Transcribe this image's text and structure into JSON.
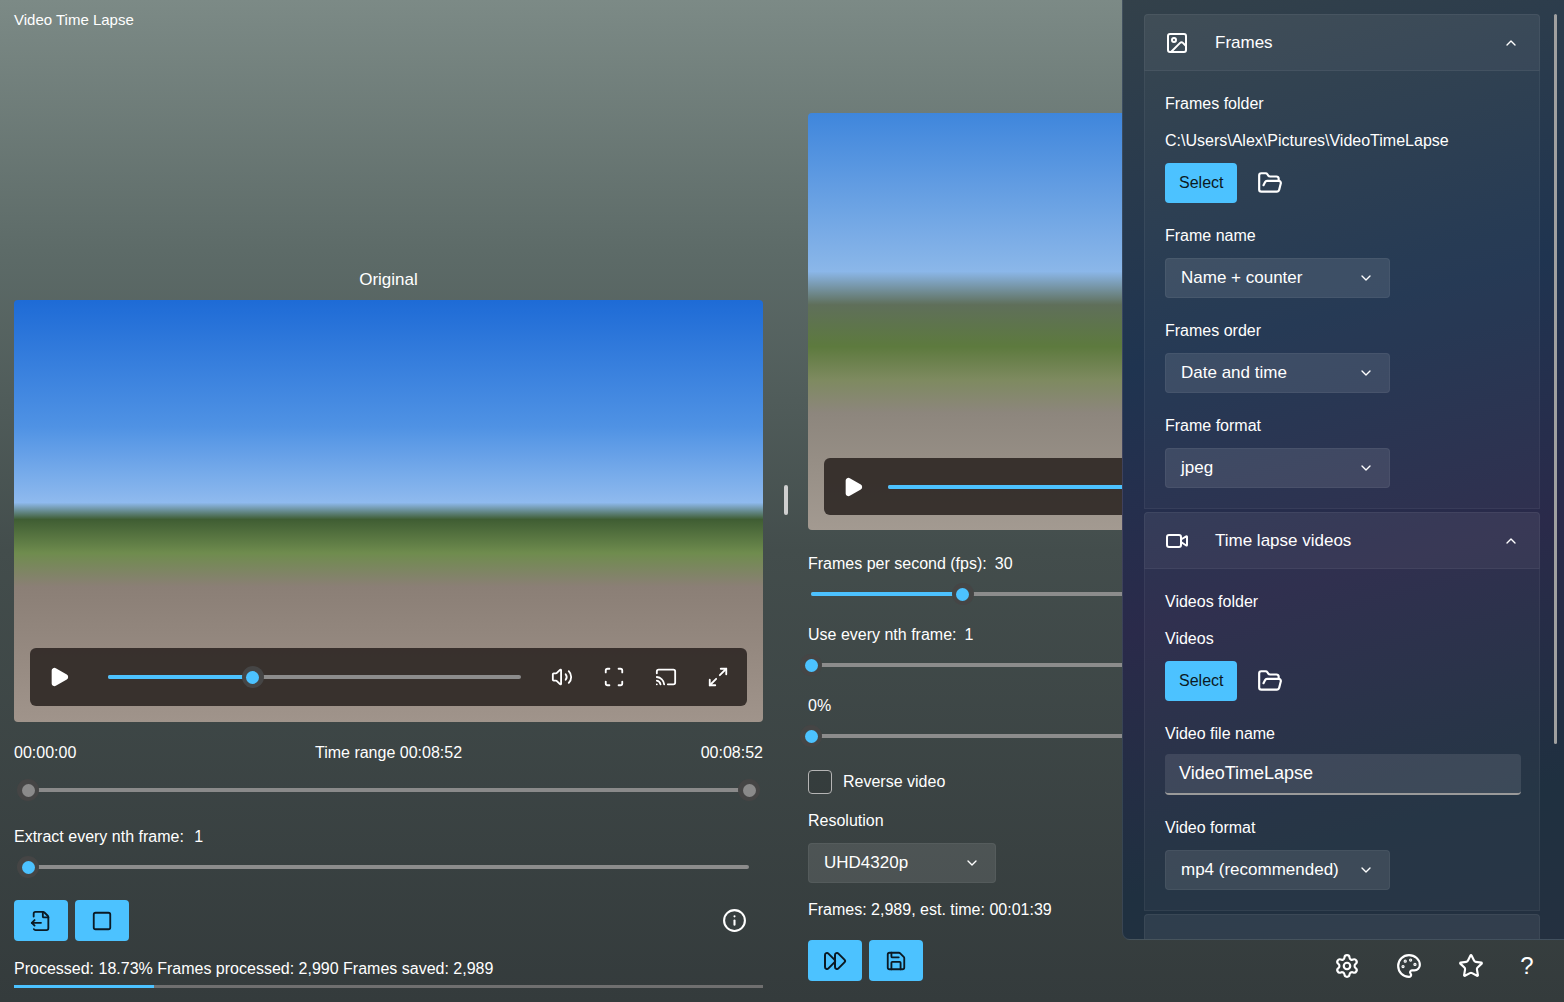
{
  "window": {
    "title": "Video Time Lapse"
  },
  "original": {
    "label": "Original",
    "player": {
      "level": 0.35
    },
    "time_start": "00:00:00",
    "time_range": "Time range 00:08:52",
    "time_end": "00:08:52",
    "range": {
      "start": 0,
      "end": 1,
      "disabled": true
    },
    "extract": {
      "label": "Extract every nth frame:",
      "value": "1",
      "level": 0
    },
    "status": "Processed: 18.73% Frames processed: 2,990 Frames saved: 2,989",
    "progress": {
      "level": 0.1873
    }
  },
  "preview": {
    "player": {
      "level": 0.6
    },
    "sliders": [
      {
        "label": "Frames per second (fps):",
        "value": "30",
        "level": 0.21
      },
      {
        "label": "Use every nth frame:",
        "value": "1",
        "level": 0
      },
      {
        "label": "0%",
        "value": "",
        "level": 0
      }
    ],
    "reverse": {
      "label": "Reverse video",
      "checked": false
    },
    "resolution": {
      "label": "Resolution",
      "value": "UHD4320p"
    },
    "summary": "Frames: 2,989, est. time: 00:01:39"
  },
  "settings_panel": {
    "sections": [
      {
        "title": "Frames",
        "icon": "image",
        "expanded": true,
        "fields": [
          {
            "kind": "folder",
            "label": "Frames folder",
            "value": "C:\\Users\\Alex\\Pictures\\VideoTimeLapse",
            "button": "Select"
          },
          {
            "kind": "dropdown",
            "label": "Frame name",
            "value": "Name + counter"
          },
          {
            "kind": "dropdown",
            "label": "Frames order",
            "value": "Date and time"
          },
          {
            "kind": "dropdown",
            "label": "Frame format",
            "value": "jpeg"
          }
        ]
      },
      {
        "title": "Time lapse videos",
        "icon": "video",
        "expanded": true,
        "fields": [
          {
            "kind": "folder",
            "label": "Videos folder",
            "value": "Videos",
            "button": "Select"
          },
          {
            "kind": "text",
            "label": "Video file name",
            "value": "VideoTimeLapse"
          },
          {
            "kind": "dropdown",
            "label": "Video format",
            "value": "mp4 (recommended)"
          }
        ]
      }
    ]
  },
  "footer": {
    "help": "?"
  }
}
